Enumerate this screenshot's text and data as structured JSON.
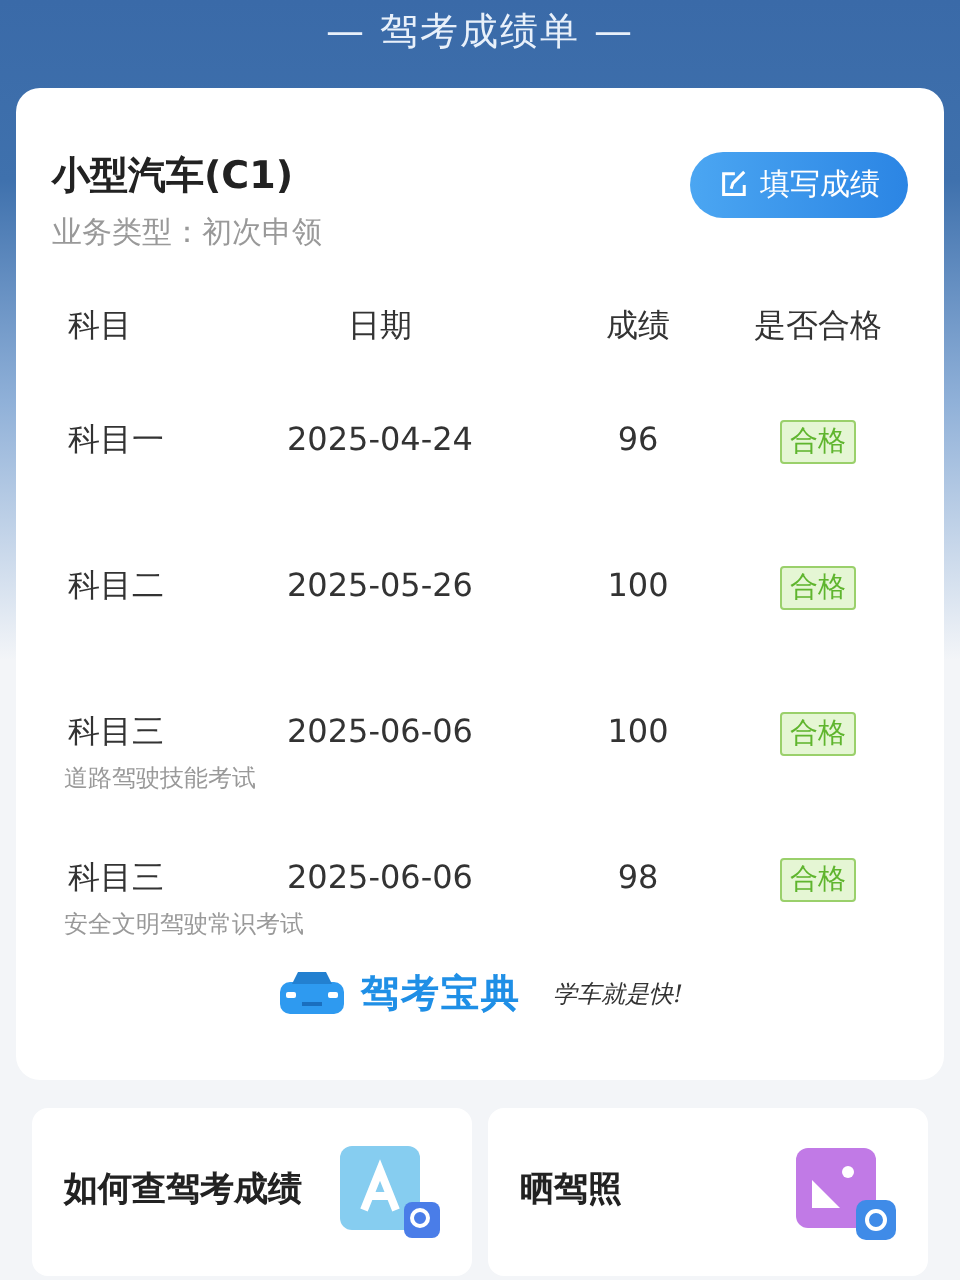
{
  "header": {
    "title": "— 驾考成绩单 —"
  },
  "license": {
    "name": "小型汽车(C1)",
    "business_type": "业务类型：初次申领",
    "fill_button": "填写成绩"
  },
  "table": {
    "columns": [
      "科目",
      "日期",
      "成绩",
      "是否合格"
    ],
    "rows": [
      {
        "subject": "科目一",
        "date": "2025-04-24",
        "score": "96",
        "result": "合格",
        "passed": true
      },
      {
        "subject": "科目二",
        "date": "2025-05-26",
        "score": "100",
        "result": "合格",
        "passed": true
      },
      {
        "subject": "科目三",
        "date": "2025-06-06",
        "score": "100",
        "result": "合格",
        "passed": true,
        "note": "道路驾驶技能考试"
      },
      {
        "subject": "科目三",
        "date": "2025-06-06",
        "score": "98",
        "result": "合格",
        "passed": true,
        "note": "安全文明驾驶常识考试"
      }
    ]
  },
  "brand": {
    "name": "驾考宝典",
    "slogan": "学车就是快!"
  },
  "shortcuts": [
    {
      "label": "如何查驾考成绩",
      "kind": "search"
    },
    {
      "label": "晒驾照",
      "kind": "photo"
    }
  ]
}
